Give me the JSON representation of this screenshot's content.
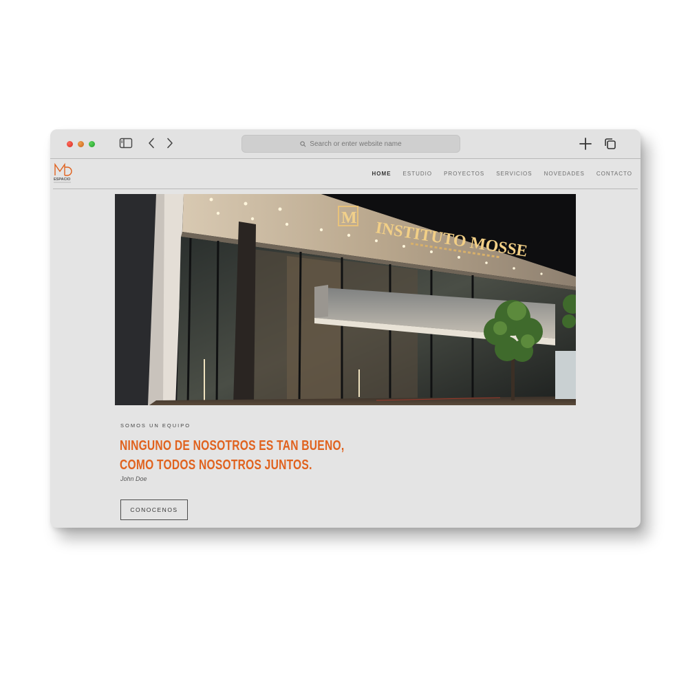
{
  "browser": {
    "address_placeholder": "Search or enter website name",
    "traffic_lights": [
      "#d42a1e",
      "#c8621a",
      "#1f9c2a"
    ]
  },
  "site": {
    "logo_text": "MD",
    "logo_subtitle": "ESPACIO",
    "nav": [
      {
        "label": "HOME",
        "active": true
      },
      {
        "label": "ESTUDIO",
        "active": false
      },
      {
        "label": "PROYECTOS",
        "active": false
      },
      {
        "label": "SERVICIOS",
        "active": false
      },
      {
        "label": "NOVEDADES",
        "active": false
      },
      {
        "label": "CONTACTO",
        "active": false
      }
    ],
    "accent_color": "#e0621e"
  },
  "hero": {
    "sign_logo": "M",
    "sign_text": "INSTITUTO MOSSE"
  },
  "content": {
    "eyebrow": "SOMOS UN EQUIPO",
    "headline_line1": "NINGUNO DE NOSOTROS ES TAN BUENO,",
    "headline_line2": "COMO TODOS NOSOTROS JUNTOS.",
    "author": "John Doe",
    "cta_label": "CONOCENOS"
  }
}
